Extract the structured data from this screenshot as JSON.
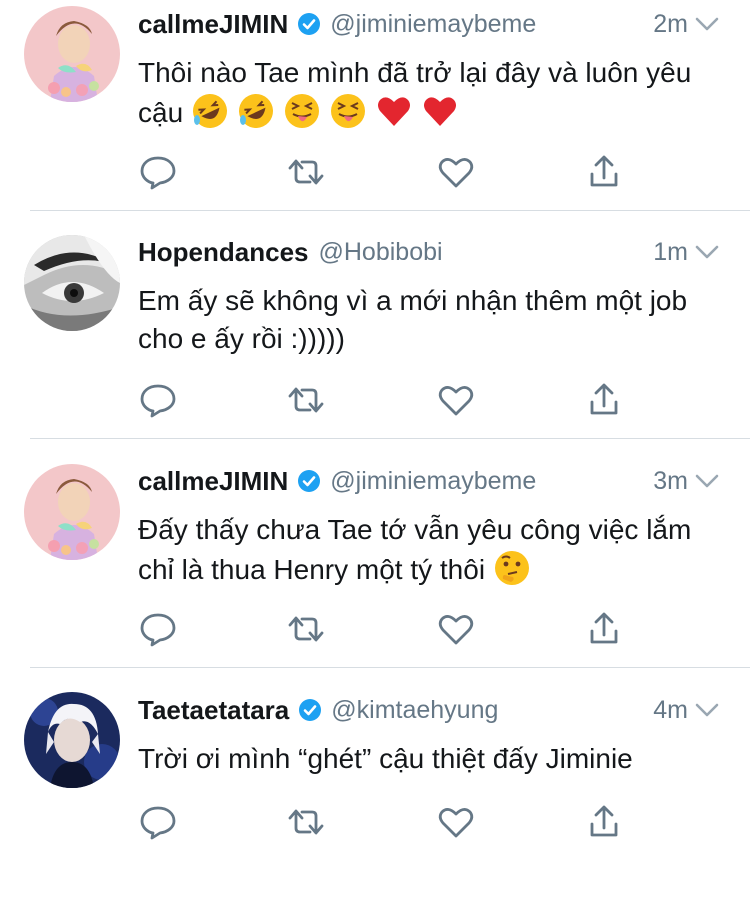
{
  "colors": {
    "name": "#14171a",
    "secondary": "#657786",
    "verified": "#1da1f2",
    "icon": "#657786",
    "divider": "#d7dde2"
  },
  "tweets": [
    {
      "name": "callmeJIMIN",
      "verified": true,
      "handle": "@jiminiemaybeme",
      "time": "2m",
      "avatar": "avatar-pastel-portrait",
      "text": "Thôi nào Tae mình đã trở lại đây và luôn yêu cậu",
      "emojis": [
        "rofl-emoji",
        "rofl-emoji",
        "squint-tongue-emoji",
        "squint-tongue-emoji",
        "red-heart-emoji",
        "red-heart-emoji"
      ]
    },
    {
      "name": "Hopendances",
      "verified": false,
      "handle": "@Hobibobi",
      "time": "1m",
      "avatar": "avatar-grayscale-eye",
      "text": "Em ấy sẽ không vì a mới nhận thêm một job cho e ấy rồi :)))))",
      "emojis": []
    },
    {
      "name": "callmeJIMIN",
      "verified": true,
      "handle": "@jiminiemaybeme",
      "time": "3m",
      "avatar": "avatar-pastel-portrait",
      "text": "Đấy thấy chưa Tae tớ vẫn yêu công việc lắm chỉ là thua Henry một tý thôi",
      "emojis": [
        "thinking-emoji"
      ]
    },
    {
      "name": "Taetaetatara",
      "verified": true,
      "handle": "@kimtaehyung",
      "time": "4m",
      "avatar": "avatar-blue-stage-photo",
      "text": "Trời ơi mình “ghét” cậu thiệt đấy Jiminie",
      "emojis": []
    }
  ]
}
